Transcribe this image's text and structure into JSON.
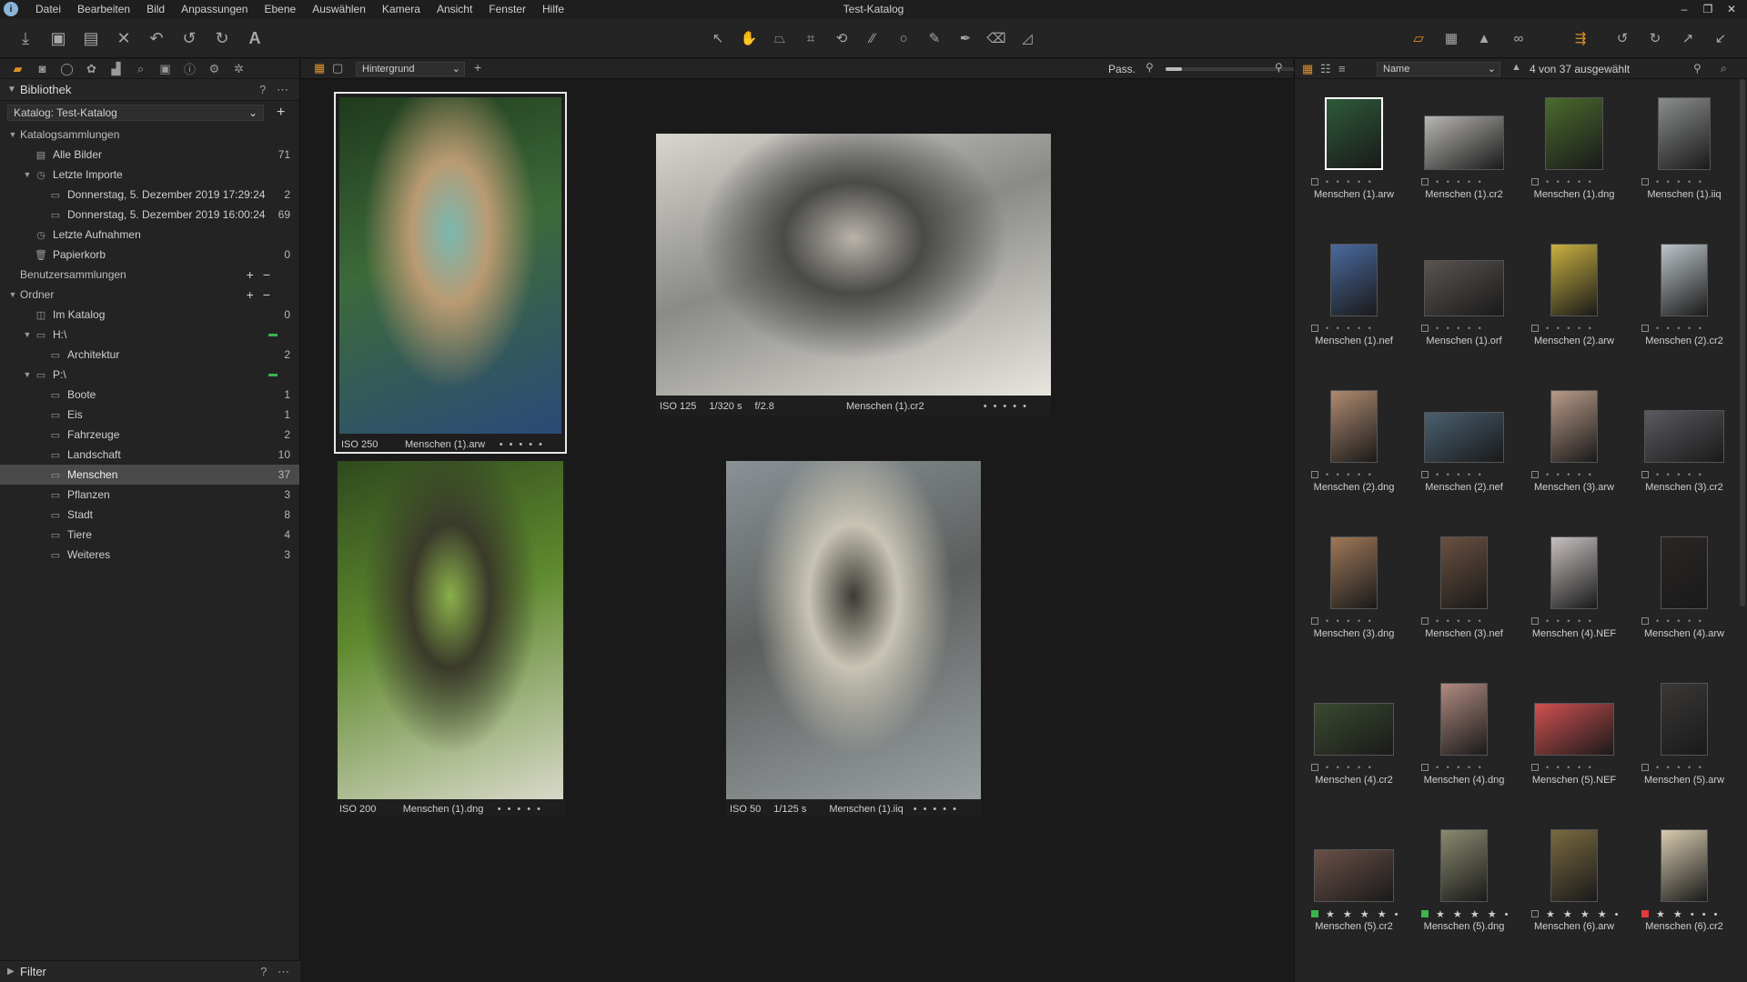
{
  "menu": {
    "items": [
      "Datei",
      "Bearbeiten",
      "Bild",
      "Anpassungen",
      "Ebene",
      "Auswählen",
      "Kamera",
      "Ansicht",
      "Fenster",
      "Hilfe"
    ],
    "title": "Test-Katalog",
    "logo": "i"
  },
  "library": {
    "header": "Bibliothek",
    "help": "?",
    "more": "⋯",
    "catalog_select": "Katalog: Test-Katalog",
    "tree": [
      {
        "label": "Katalogsammlungen",
        "count": "",
        "level": 0,
        "type": "section",
        "chevron": "open",
        "icon": ""
      },
      {
        "label": "Alle Bilder",
        "count": "71",
        "level": 1,
        "type": "item",
        "chevron": "",
        "icon": "images-icon"
      },
      {
        "label": "Letzte Importe",
        "count": "",
        "level": 1,
        "type": "item",
        "chevron": "open",
        "icon": "clock-icon"
      },
      {
        "label": "Donnerstag, 5. Dezember 2019 17:29:24",
        "count": "2",
        "level": 2,
        "type": "item",
        "chevron": "",
        "icon": "album-icon"
      },
      {
        "label": "Donnerstag, 5. Dezember 2019 16:00:24",
        "count": "69",
        "level": 2,
        "type": "item",
        "chevron": "",
        "icon": "album-icon"
      },
      {
        "label": "Letzte Aufnahmen",
        "count": "",
        "level": 1,
        "type": "item",
        "chevron": "",
        "icon": "clock-icon"
      },
      {
        "label": "Papierkorb",
        "count": "0",
        "level": 1,
        "type": "item",
        "chevron": "",
        "icon": "trash-icon"
      },
      {
        "label": "Benutzersammlungen",
        "count": "",
        "level": 0,
        "type": "section",
        "chevron": "",
        "icon": "",
        "actions": "plus-minus"
      },
      {
        "label": "Ordner",
        "count": "",
        "level": 0,
        "type": "section",
        "chevron": "open",
        "icon": "",
        "actions": "plus-minus"
      },
      {
        "label": "Im Katalog",
        "count": "0",
        "level": 1,
        "type": "item",
        "chevron": "",
        "icon": "catalog-icon"
      },
      {
        "label": "H:\\",
        "count": "",
        "level": 1,
        "type": "item",
        "chevron": "open",
        "icon": "drive-icon",
        "green": true
      },
      {
        "label": "Architektur",
        "count": "2",
        "level": 2,
        "type": "item",
        "chevron": "",
        "icon": "folder-icon"
      },
      {
        "label": "P:\\",
        "count": "",
        "level": 1,
        "type": "item",
        "chevron": "open",
        "icon": "drive-icon",
        "green": true
      },
      {
        "label": "Boote",
        "count": "1",
        "level": 2,
        "type": "item",
        "chevron": "",
        "icon": "folder-icon"
      },
      {
        "label": "Eis",
        "count": "1",
        "level": 2,
        "type": "item",
        "chevron": "",
        "icon": "folder-icon"
      },
      {
        "label": "Fahrzeuge",
        "count": "2",
        "level": 2,
        "type": "item",
        "chevron": "",
        "icon": "folder-icon"
      },
      {
        "label": "Landschaft",
        "count": "10",
        "level": 2,
        "type": "item",
        "chevron": "",
        "icon": "folder-icon"
      },
      {
        "label": "Menschen",
        "count": "37",
        "level": 2,
        "type": "item",
        "chevron": "",
        "icon": "folder-icon",
        "selected": true
      },
      {
        "label": "Pflanzen",
        "count": "3",
        "level": 2,
        "type": "item",
        "chevron": "",
        "icon": "folder-icon"
      },
      {
        "label": "Stadt",
        "count": "8",
        "level": 2,
        "type": "item",
        "chevron": "",
        "icon": "folder-icon"
      },
      {
        "label": "Tiere",
        "count": "4",
        "level": 2,
        "type": "item",
        "chevron": "",
        "icon": "folder-icon"
      },
      {
        "label": "Weiteres",
        "count": "3",
        "level": 2,
        "type": "item",
        "chevron": "",
        "icon": "folder-icon"
      }
    ],
    "filter": "Filter"
  },
  "viewer": {
    "background_select": "Hintergrund",
    "zoom_label": "Pass.",
    "photos": [
      {
        "iso": "ISO 250",
        "shutter": "",
        "aperture": "",
        "name": "Menschen (1).arw",
        "selected": true,
        "colors": [
          "#1f3a1c",
          "#3d6a3a",
          "#7ab8b0",
          "#b99a72",
          "#2b4a78"
        ]
      },
      {
        "iso": "ISO 125",
        "shutter": "1/320 s",
        "aperture": "f/2.8",
        "name": "Menschen (1).cr2",
        "selected": false,
        "colors": [
          "#d9d6d0",
          "#8a8a86",
          "#b9b4ab",
          "#4a4a48",
          "#e8e5df"
        ]
      },
      {
        "iso": "ISO 200",
        "shutter": "",
        "aperture": "",
        "name": "Menschen (1).dng",
        "selected": false,
        "colors": [
          "#2f4a1e",
          "#5f8a2e",
          "#8ab04a",
          "#3a3a2a",
          "#d8d8c8"
        ]
      },
      {
        "iso": "ISO 50",
        "shutter": "1/125 s",
        "aperture": "",
        "name": "Menschen (1).iiq",
        "selected": false,
        "colors": [
          "#8a9296",
          "#5c5f5e",
          "#3c3a36",
          "#c8c4b4",
          "#9aa0a2"
        ]
      }
    ]
  },
  "browser": {
    "sort_select": "Name",
    "count_label": "4 von 37 ausgewählt",
    "thumbs": [
      {
        "name": "Menschen (1).arw",
        "stars": 0,
        "mark": "",
        "active": true,
        "color": "#2d5a3a"
      },
      {
        "name": "Menschen (1).cr2",
        "stars": 0,
        "mark": "",
        "active": false,
        "color": "#b8b6b2"
      },
      {
        "name": "Menschen (1).dng",
        "stars": 0,
        "mark": "",
        "active": false,
        "color": "#4a6a2e"
      },
      {
        "name": "Menschen (1).iiq",
        "stars": 0,
        "mark": "",
        "active": false,
        "color": "#8a8e8c"
      },
      {
        "name": "Menschen (1).nef",
        "stars": 0,
        "mark": "",
        "active": false,
        "color": "#4a6aa0"
      },
      {
        "name": "Menschen (1).orf",
        "stars": 0,
        "mark": "",
        "active": false,
        "color": "#5a5450"
      },
      {
        "name": "Menschen (2).arw",
        "stars": 0,
        "mark": "",
        "active": false,
        "color": "#c8b040"
      },
      {
        "name": "Menschen (2).cr2",
        "stars": 0,
        "mark": "",
        "active": false,
        "color": "#bcc4c8"
      },
      {
        "name": "Menschen (2).dng",
        "stars": 0,
        "mark": "",
        "active": false,
        "color": "#b08a70"
      },
      {
        "name": "Menschen (2).nef",
        "stars": 0,
        "mark": "",
        "active": false,
        "color": "#4a6070"
      },
      {
        "name": "Menschen (3).arw",
        "stars": 0,
        "mark": "",
        "active": false,
        "color": "#b89a88"
      },
      {
        "name": "Menschen (3).cr2",
        "stars": 0,
        "mark": "",
        "active": false,
        "color": "#5a5a60"
      },
      {
        "name": "Menschen (3).dng",
        "stars": 0,
        "mark": "",
        "active": false,
        "color": "#a07858"
      },
      {
        "name": "Menschen (3).nef",
        "stars": 0,
        "mark": "",
        "active": false,
        "color": "#6a5040"
      },
      {
        "name": "Menschen (4).NEF",
        "stars": 0,
        "mark": "",
        "active": false,
        "color": "#c8c0c0"
      },
      {
        "name": "Menschen (4).arw",
        "stars": 0,
        "mark": "",
        "active": false,
        "color": "#2a2624"
      },
      {
        "name": "Menschen (4).cr2",
        "stars": 0,
        "mark": "",
        "active": false,
        "color": "#3a4a30"
      },
      {
        "name": "Menschen (4).dng",
        "stars": 0,
        "mark": "",
        "active": false,
        "color": "#b08a80"
      },
      {
        "name": "Menschen (5).NEF",
        "stars": 0,
        "mark": "",
        "active": false,
        "color": "#d05050"
      },
      {
        "name": "Menschen (5).arw",
        "stars": 0,
        "mark": "",
        "active": false,
        "color": "#3a3836"
      },
      {
        "name": "Menschen (5).cr2",
        "stars": 4,
        "mark": "green",
        "active": false,
        "color": "#6a5048"
      },
      {
        "name": "Menschen (5).dng",
        "stars": 4,
        "mark": "green",
        "active": false,
        "color": "#8a8a70"
      },
      {
        "name": "Menschen (6).arw",
        "stars": 4,
        "mark": "",
        "active": false,
        "color": "#7a6a40"
      },
      {
        "name": "Menschen (6).cr2",
        "stars": 2,
        "mark": "red",
        "active": false,
        "color": "#d8ccb0"
      }
    ]
  },
  "icons": {
    "toolbar_left": [
      "import-icon",
      "camera-icon",
      "export-icon",
      "delete-icon",
      "undo-all-icon",
      "undo-icon",
      "redo-icon",
      "text-icon"
    ],
    "toolbar_center": [
      "select-icon",
      "pan-icon",
      "keystone-icon",
      "crop-icon",
      "rotate-icon",
      "straighten-icon",
      "circle-icon",
      "brush-icon",
      "pen-icon",
      "erase-icon",
      "gradient-icon"
    ],
    "toolbar_right": [
      "view-mode-icon",
      "grid-icon",
      "warning-icon",
      "glasses-icon",
      "copy-adjust-icon",
      "reset-icon",
      "redo-icon",
      "expand-icon",
      "collapse-icon"
    ]
  },
  "accent": "#e0902a"
}
